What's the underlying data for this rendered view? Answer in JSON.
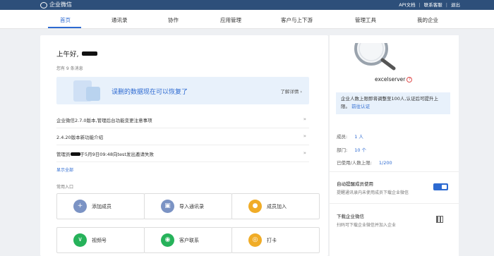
{
  "topbar": {
    "logo_text": "企业微信",
    "links": [
      "API文档",
      "联系客服",
      "退出"
    ]
  },
  "nav": {
    "items": [
      "首页",
      "通讯录",
      "协作",
      "应用管理",
      "客户与上下游",
      "管理工具",
      "我的企业"
    ],
    "active_index": 0,
    "accent_color": "#2d6ad1"
  },
  "home": {
    "greeting": "上午好,",
    "message_count": "您有 9 条消息",
    "banner": {
      "text": "误删的数据现在可以恢复了",
      "link": "了解详情 ›"
    },
    "news": [
      {
        "text": "企业微信2.7.0版本,管理后台功能变更注意事项"
      },
      {
        "text": "2.4.20版本新功能介绍"
      },
      {
        "prefix": "管理员",
        "text": "于5月9日09:48向test发出邀请失败"
      }
    ],
    "news_arrow": "»",
    "show_all": "显示全部",
    "common_title": "常用入口",
    "shortcuts": [
      {
        "label": "添加成员",
        "icon": "add-member-icon",
        "color": "#7b93c4"
      },
      {
        "label": "导入通讯录",
        "icon": "import-contacts-icon",
        "color": "#7b93c4"
      },
      {
        "label": "成员加入",
        "icon": "member-join-icon",
        "color": "#f0ac27"
      },
      {
        "label": "视频号",
        "icon": "video-channel-icon",
        "color": "#26b25a"
      },
      {
        "label": "客户联系",
        "icon": "customer-contact-icon",
        "color": "#26b25a"
      },
      {
        "label": "打卡",
        "icon": "check-in-icon",
        "color": "#f0ac27"
      }
    ]
  },
  "sidebar": {
    "corp_name": "excelserver",
    "help_glyph": "?",
    "notice_text": "企业人数上限即将调整至100人,认证后可提升上限。",
    "notice_link": "前往认证",
    "stats": [
      {
        "label": "成员:",
        "value": "1 人"
      },
      {
        "label": "部门:",
        "value": "10 个"
      },
      {
        "label": "已使用/人数上限:",
        "value": "1/200"
      }
    ],
    "auto_remind": {
      "title": "自动提醒成员使用",
      "desc": "提醒通讯录内未使用成员下载企业微信",
      "enabled": true
    },
    "download": {
      "title": "下载企业微信",
      "desc": "扫码可下载企业微信并加入企业"
    }
  }
}
